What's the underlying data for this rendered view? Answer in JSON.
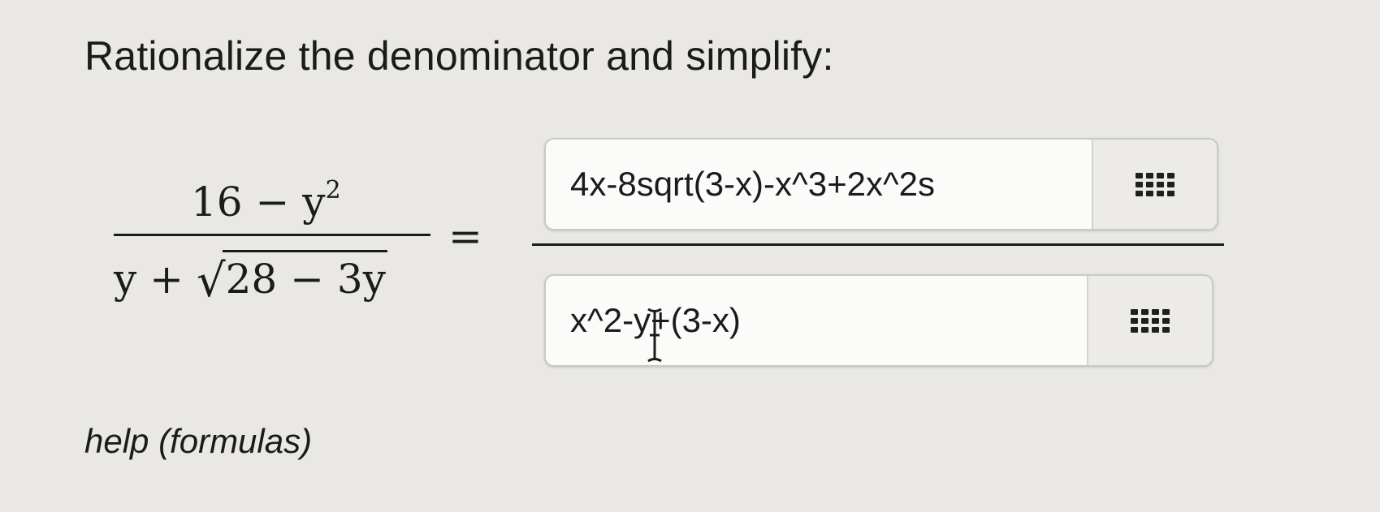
{
  "instruction": "Rationalize the denominator and simplify:",
  "expression": {
    "numerator": "16 − y",
    "numerator_exponent": "2",
    "denominator_prefix": "y + ",
    "radical_symbol": "√",
    "radicand": "28 − 3y"
  },
  "equals_sign": "=",
  "answer": {
    "numerator_value": "4x-8sqrt(3-x)-x^3+2x^2s",
    "denominator_value": "x^2-y+(3-x)"
  },
  "keyboard_icon": "grid-keypad-icon",
  "help_link": "help (formulas)"
}
